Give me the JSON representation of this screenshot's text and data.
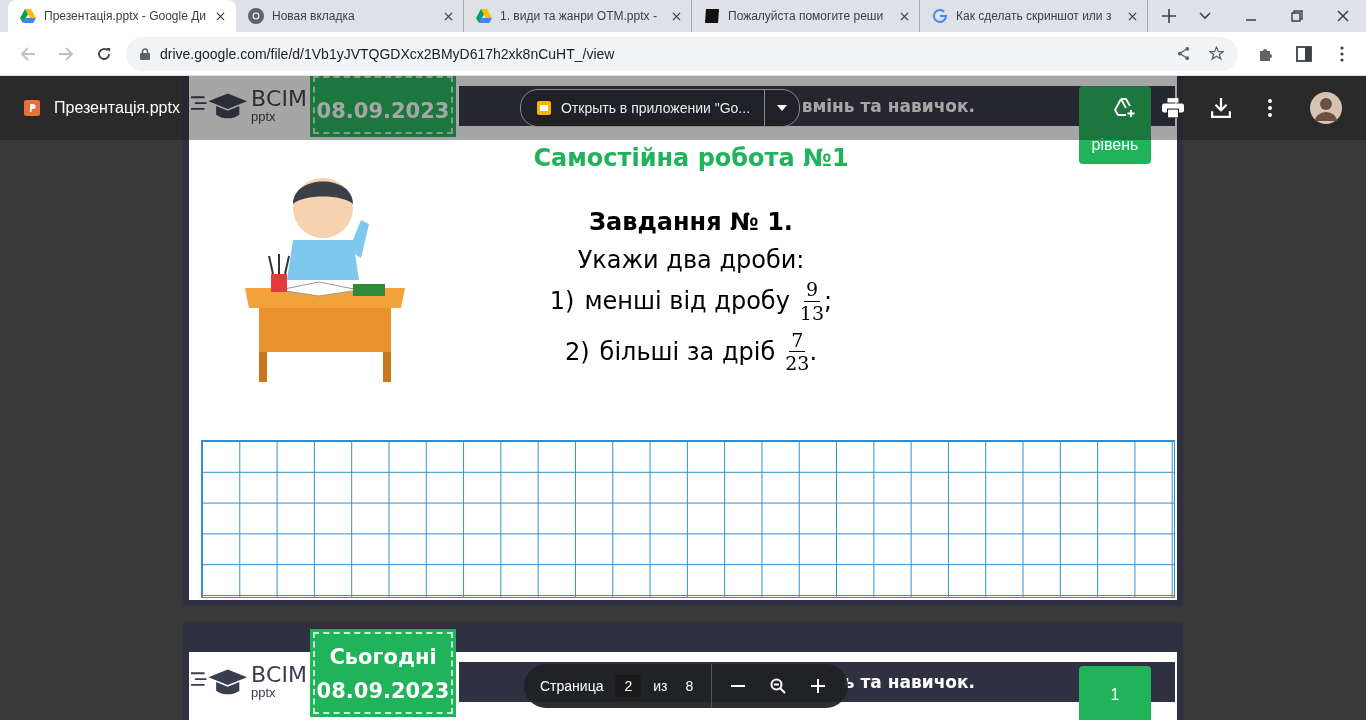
{
  "browser": {
    "tabs": [
      {
        "title": "Презентація.pptx - Google Ди",
        "kind": "drive",
        "selected": true
      },
      {
        "title": "Новая вкладка",
        "kind": "chrome",
        "selected": false
      },
      {
        "title": "1. види та жанри ОТМ.pptx - ",
        "kind": "drive",
        "selected": false
      },
      {
        "title": "Пожалуйста помогите реши",
        "kind": "site",
        "selected": false
      },
      {
        "title": "Как сделать скриншот или з",
        "kind": "google",
        "selected": false
      }
    ],
    "url": "drive.google.com/file/d/1Vb1yJVTQGDXcx2BMyD617h2xk8nCuHT_/view"
  },
  "viewer": {
    "file_name": "Презентація.pptx",
    "open_button": "Открыть в приложении \"Go...",
    "page_nav": {
      "label": "Страница",
      "page": "2",
      "of": "из",
      "total": "8"
    }
  },
  "slides": [
    {
      "logo": "ВСІМ",
      "logo_sub": "pptx",
      "date_lines": [
        "08.09.2023"
      ],
      "heading": "вмінь та навичок.",
      "level_lines": [
        "рівень"
      ],
      "content": {
        "title": "Самостійна робота №1",
        "task": "Завдання № 1.",
        "prompt": "Укажи два дроби:",
        "items": [
          {
            "number": "1)",
            "text": "менші від дробу",
            "numerator": "9",
            "denominator": "13",
            "end": ";"
          },
          {
            "number": "2)",
            "text": "більші за дріб",
            "numerator": "7",
            "denominator": "23",
            "end": "."
          }
        ]
      }
    },
    {
      "logo": "ВСІМ",
      "logo_sub": "pptx",
      "date_lines": [
        "Сьогодні",
        "08.09.2023"
      ],
      "heading": "ь та навичок.",
      "level_lines": [
        "1"
      ]
    }
  ]
}
